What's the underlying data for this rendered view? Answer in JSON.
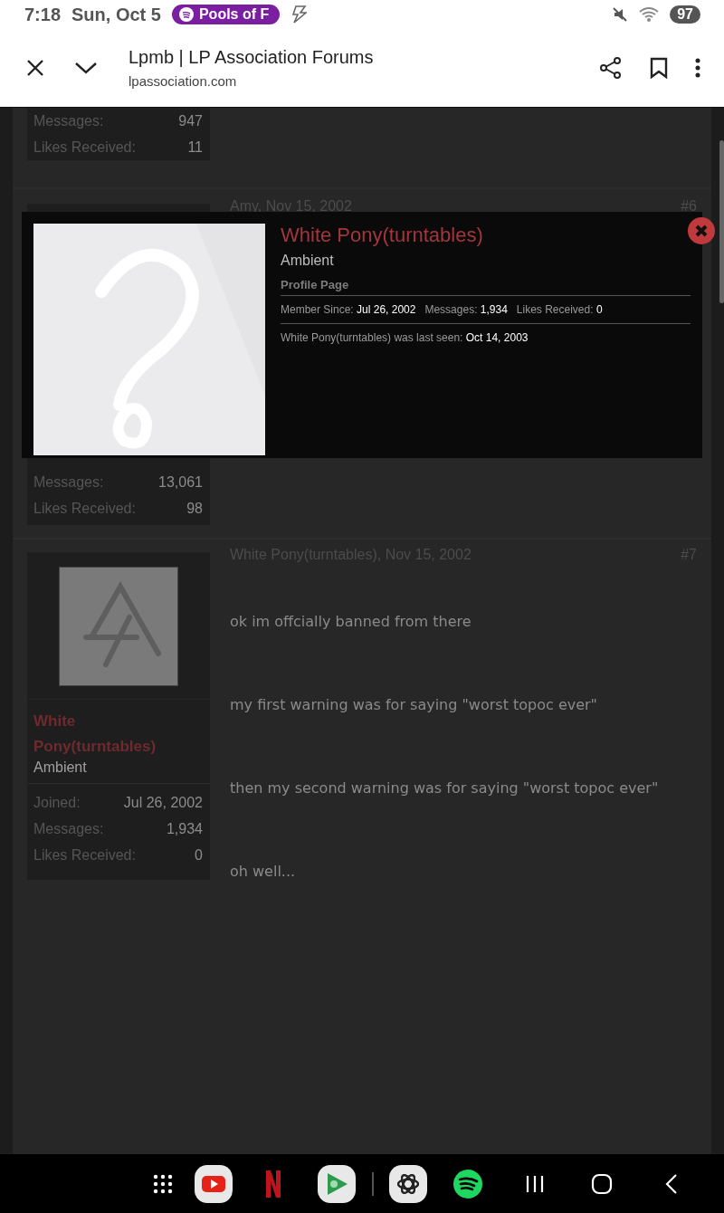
{
  "status_bar": {
    "time": "7:18",
    "date": "Sun, Oct 5",
    "media_pill": "Pools of F",
    "battery": "97"
  },
  "browser": {
    "title": "Lpmb | LP Association Forums",
    "url": "lpassociation.com"
  },
  "posts": [
    {
      "kind": "tail",
      "stats": [
        {
          "label": "Messages:",
          "value": "947"
        },
        {
          "label": "Likes Received:",
          "value": "11"
        }
      ]
    },
    {
      "kind": "covered",
      "author_date": "Amy, Nov 15, 2002",
      "number": "#6",
      "stats": [
        {
          "label": "Messages:",
          "value": "13,061"
        },
        {
          "label": "Likes Received:",
          "value": "98"
        }
      ]
    },
    {
      "kind": "full",
      "author_date": "White Pony(turntables), Nov 15, 2002",
      "number": "#7",
      "name": "White Pony(turntables)",
      "title": "Ambient",
      "stats": [
        {
          "label": "Joined:",
          "value": "Jul 26, 2002"
        },
        {
          "label": "Messages:",
          "value": "1,934"
        },
        {
          "label": "Likes Received:",
          "value": "0"
        }
      ],
      "body": [
        "ok im offcially banned from there",
        "my first warning was for saying \"worst topoc ever\"",
        "then my second warning was for saying \"worst topoc ever\"",
        "oh well..."
      ]
    }
  ],
  "popup": {
    "name": "White Pony(turntables)",
    "title": "Ambient",
    "link": "Profile Page",
    "stats": [
      {
        "label": "Member Since:",
        "value": "Jul 26, 2002"
      },
      {
        "label": "Messages:",
        "value": "1,934"
      },
      {
        "label": "Likes Received:",
        "value": "0"
      }
    ],
    "last_seen": {
      "label": "White Pony(turntables) was last seen:",
      "value": "Oct 14, 2003"
    }
  },
  "dock": [
    {
      "kind": "apps"
    },
    {
      "kind": "youtube"
    },
    {
      "kind": "netflix"
    },
    {
      "kind": "games"
    },
    {
      "kind": "divider"
    },
    {
      "kind": "chat"
    },
    {
      "kind": "music"
    },
    {
      "kind": "recents"
    },
    {
      "kind": "home"
    },
    {
      "kind": "back"
    }
  ]
}
